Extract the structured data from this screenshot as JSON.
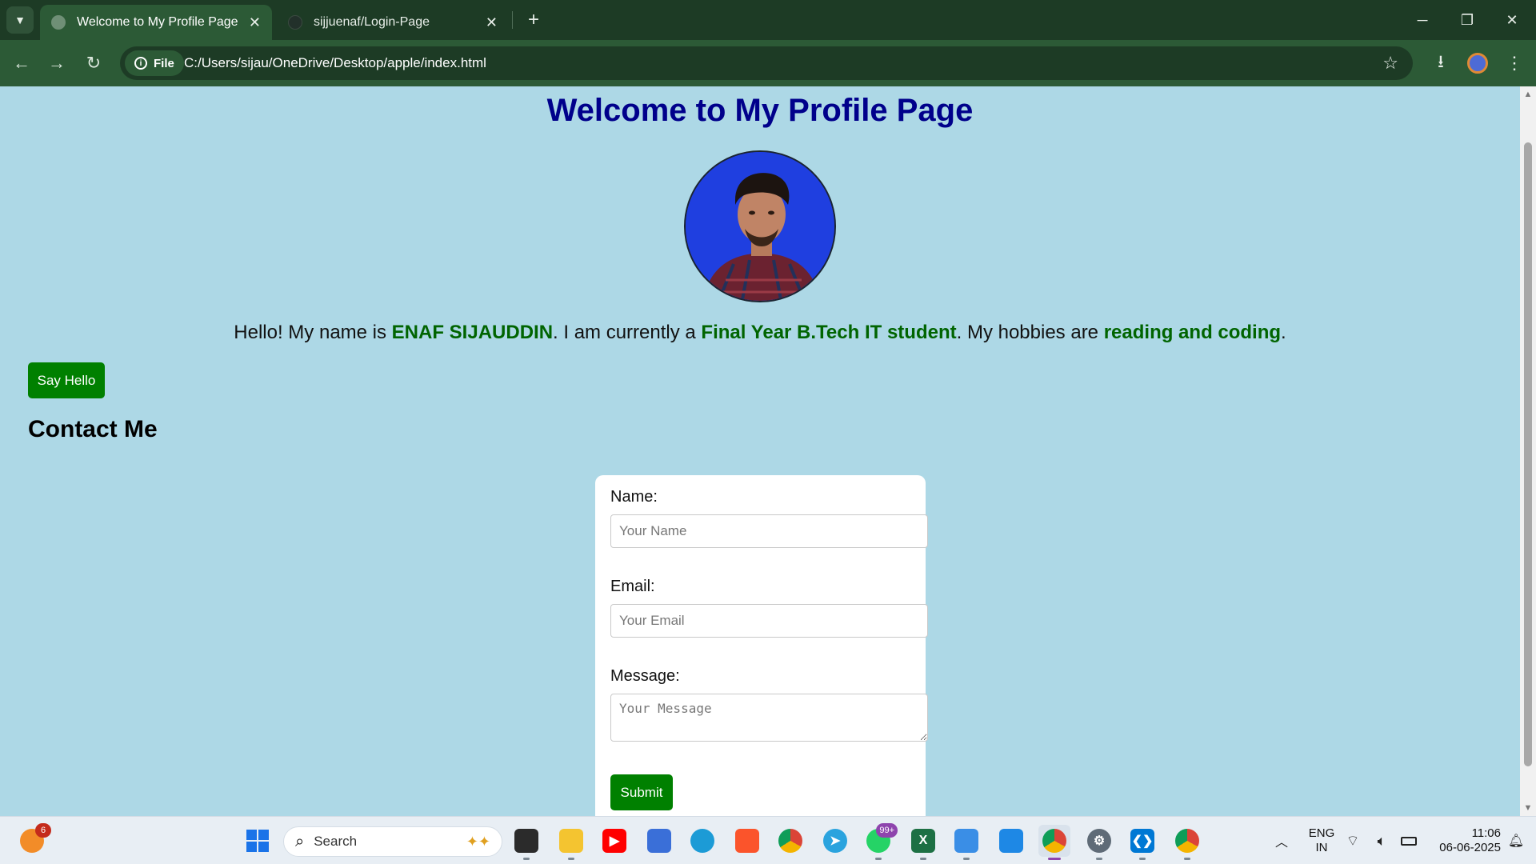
{
  "browser": {
    "tabs": [
      {
        "title": "Welcome to My Profile Page",
        "active": true
      },
      {
        "title": "sijjuenaf/Login-Page",
        "active": false
      }
    ],
    "address": {
      "scheme_chip": "File",
      "url": "C:/Users/sijau/OneDrive/Desktop/apple/index.html"
    }
  },
  "page": {
    "title": "Welcome to My Profile Page",
    "intro": {
      "t1": "Hello! My name is ",
      "name": "ENAF SIJAUDDIN",
      "t2": ". I am currently a ",
      "status": "Final Year B.Tech IT student",
      "t3": ". My hobbies are ",
      "hobbies": "reading and coding",
      "t4": "."
    },
    "say_hello_label": "Say Hello",
    "contact_heading": "Contact Me",
    "form": {
      "name_label": "Name:",
      "name_placeholder": "Your Name",
      "email_label": "Email:",
      "email_placeholder": "Your Email",
      "message_label": "Message:",
      "message_placeholder": "Your Message",
      "submit_label": "Submit"
    }
  },
  "taskbar": {
    "search_placeholder": "Search",
    "weather_badge": "6",
    "whatsapp_badge": "99+",
    "language": {
      "line1": "ENG",
      "line2": "IN"
    },
    "clock": {
      "time": "11:06",
      "date": "06-06-2025"
    }
  },
  "colors": {
    "page_background": "#add8e6",
    "title_color": "#00008b",
    "highlight_text": "#006400",
    "button_green": "#008000",
    "browser_frame": "#2c5a36"
  }
}
